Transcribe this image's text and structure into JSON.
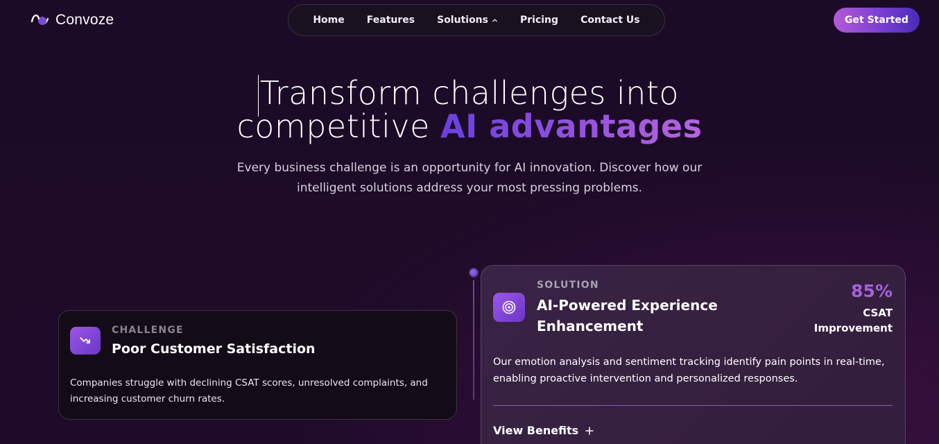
{
  "brand": {
    "name": "Convoze"
  },
  "nav": {
    "items": [
      {
        "label": "Home"
      },
      {
        "label": "Features"
      },
      {
        "label": "Solutions"
      },
      {
        "label": "Pricing"
      },
      {
        "label": "Contact Us"
      }
    ],
    "cta_label": "Get Started"
  },
  "hero": {
    "title_line1": "Transform challenges into",
    "title_line2_plain": "competitive",
    "title_line2_accent": "AI advantages",
    "subtitle": "Every business challenge is an opportunity for AI innovation. Discover how our intelligent solutions address your most pressing problems."
  },
  "challenge": {
    "tag": "CHALLENGE",
    "title": "Poor Customer Satisfaction",
    "body": "Companies struggle with declining CSAT scores, unresolved complaints, and increasing customer churn rates.",
    "icon": "trending-down-icon"
  },
  "solution": {
    "tag": "SOLUTION",
    "title": "AI-Powered Experience Enhancement",
    "stat_value": "85%",
    "stat_label": "CSAT Improvement",
    "body": "Our emotion analysis and sentiment tracking identify pain points in real-time, enabling proactive intervention and personalized responses.",
    "benefits_label": "View Benefits",
    "icon": "target-icon"
  },
  "colors": {
    "background": "#1c0b26",
    "accent": "#9955dd",
    "stat": "#a462dc"
  }
}
